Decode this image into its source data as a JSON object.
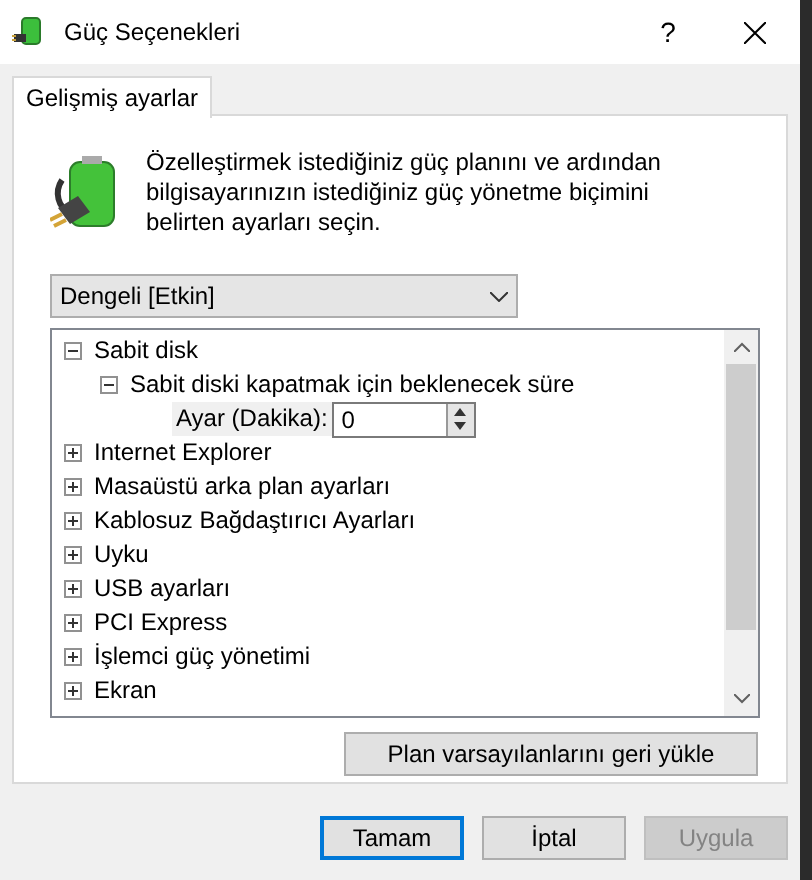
{
  "window": {
    "title": "Güç Seçenekleri",
    "help": "?"
  },
  "tabs": [
    {
      "label": "Gelişmiş ayarlar",
      "selected": true
    }
  ],
  "description": "Özelleştirmek istediğiniz güç planını ve ardından bilgisayarınızın istediğiniz güç yönetme biçimini belirten ayarları seçin.",
  "plan_dropdown": {
    "value": "Dengeli [Etkin]"
  },
  "tree": [
    {
      "kind": "group",
      "label": "Sabit disk",
      "expanded": true,
      "children": [
        {
          "kind": "group",
          "label": "Sabit diski kapatmak için beklenecek süre",
          "expanded": true,
          "children": [
            {
              "kind": "setting",
              "label": "Ayar (Dakika):",
              "value": "0"
            }
          ]
        }
      ]
    },
    {
      "kind": "group",
      "label": "Internet Explorer",
      "expanded": false
    },
    {
      "kind": "group",
      "label": "Masaüstü arka plan ayarları",
      "expanded": false
    },
    {
      "kind": "group",
      "label": "Kablosuz Bağdaştırıcı Ayarları",
      "expanded": false
    },
    {
      "kind": "group",
      "label": "Uyku",
      "expanded": false
    },
    {
      "kind": "group",
      "label": "USB ayarları",
      "expanded": false
    },
    {
      "kind": "group",
      "label": "PCI Express",
      "expanded": false
    },
    {
      "kind": "group",
      "label": "İşlemci güç yönetimi",
      "expanded": false
    },
    {
      "kind": "group",
      "label": "Ekran",
      "expanded": false
    }
  ],
  "restore_button": "Plan varsayılanlarını geri yükle",
  "buttons": [
    {
      "label": "Tamam",
      "disabled": false,
      "default": true
    },
    {
      "label": "İptal",
      "disabled": false,
      "default": false
    },
    {
      "label": "Uygula",
      "disabled": true,
      "default": false
    }
  ]
}
